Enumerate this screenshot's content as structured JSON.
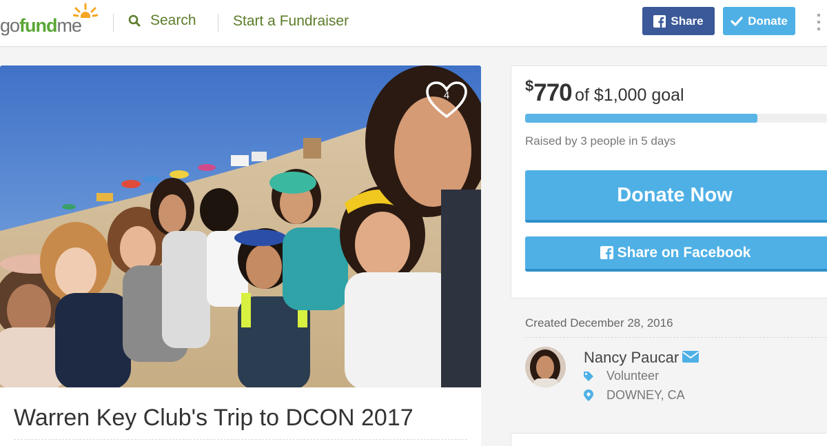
{
  "header": {
    "logo_part1": "go",
    "logo_part2": "fund",
    "logo_part3": "me",
    "search_label": "Search",
    "start_label": "Start a Fundraiser",
    "share_button": "Share",
    "donate_button": "Donate",
    "colors": {
      "brand_green": "#59a735",
      "facebook": "#3b5998",
      "donate_blue": "#4fb0e6"
    }
  },
  "campaign": {
    "like_count": "4",
    "title": "Warren Key Club's Trip to DCON 2017"
  },
  "donation": {
    "currency": "$",
    "amount": "770",
    "goal_text": "of $1,000 goal",
    "progress_fraction": 0.77,
    "raised_by": "Raised by 3 people in 5 days",
    "donate_now": "Donate Now",
    "share_facebook": "Share on Facebook"
  },
  "organizer": {
    "created": "Created December 28, 2016",
    "name": "Nancy Paucar",
    "role": "Volunteer",
    "location": "DOWNEY, CA"
  },
  "icons": {
    "search": "search-icon",
    "facebook": "facebook-icon",
    "check": "check-icon",
    "heart": "heart-icon",
    "mail": "mail-icon",
    "tag": "tag-icon",
    "location": "location-pin-icon"
  }
}
